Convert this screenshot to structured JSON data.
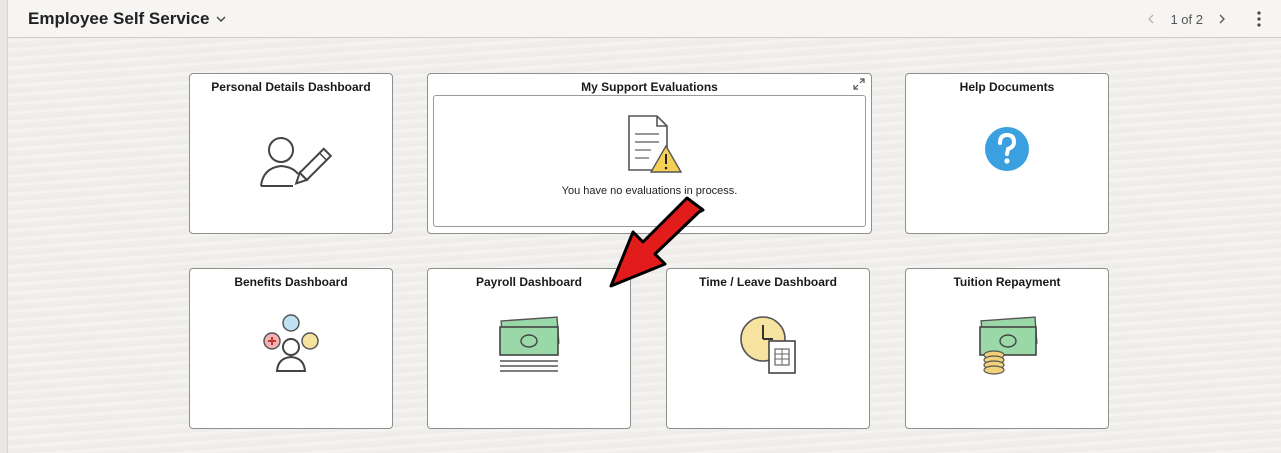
{
  "header": {
    "title": "Employee Self Service",
    "pager_text": "1 of 2"
  },
  "tiles": {
    "personal": {
      "title": "Personal Details Dashboard"
    },
    "support": {
      "title": "My Support Evaluations",
      "message": "You have no evaluations in process."
    },
    "help": {
      "title": "Help Documents"
    },
    "benefits": {
      "title": "Benefits Dashboard"
    },
    "payroll": {
      "title": "Payroll Dashboard"
    },
    "time": {
      "title": "Time / Leave Dashboard"
    },
    "tuition": {
      "title": "Tuition Repayment"
    }
  },
  "icons": {
    "personal": "user-edit-icon",
    "support": "document-warning-icon",
    "help": "help-question-icon",
    "benefits": "benefits-people-icon",
    "payroll": "money-stack-icon",
    "time": "clock-timesheet-icon",
    "tuition": "money-coins-icon"
  },
  "colors": {
    "help_blue": "#3aa0e0",
    "money_green": "#9ad9a7",
    "annotation_red": "#e21b1b",
    "tile_border": "#8f8f8f"
  }
}
